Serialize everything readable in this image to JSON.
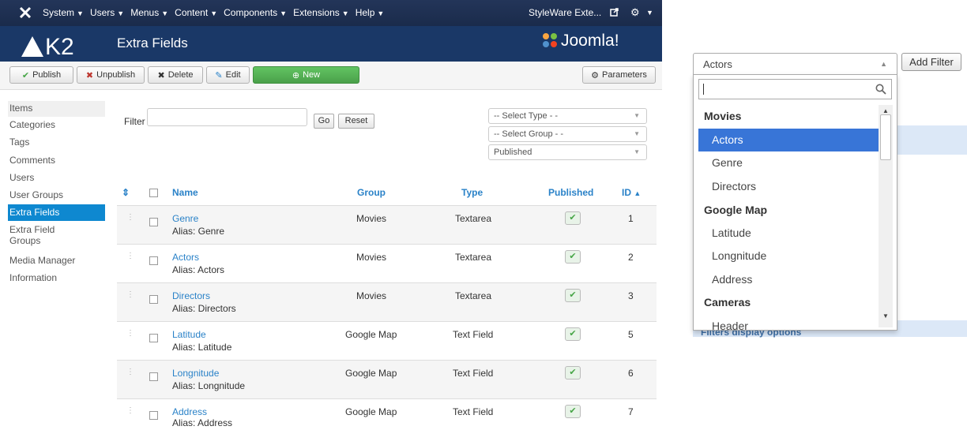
{
  "navbar": {
    "menus": [
      "System",
      "Users",
      "Menus",
      "Content",
      "Components",
      "Extensions",
      "Help"
    ],
    "site_name": "StyleWare Exte...",
    "brand": "Joomla!"
  },
  "header": {
    "logo_text": "K2",
    "title": "Extra Fields"
  },
  "toolbar": {
    "publish": "Publish",
    "unpublish": "Unpublish",
    "delete": "Delete",
    "edit": "Edit",
    "new": "New",
    "parameters": "Parameters"
  },
  "sidebar": [
    "Items",
    "Categories",
    "Tags",
    "Comments",
    "Users",
    "User Groups",
    "Extra Fields",
    "Extra Field Groups",
    "Media Manager",
    "Information"
  ],
  "filter": {
    "label": "Filter",
    "value": "",
    "go": "Go",
    "reset": "Reset"
  },
  "selects": [
    "-- Select Type - -",
    "-- Select Group - -",
    "Published"
  ],
  "table": {
    "headers": {
      "name": "Name",
      "group": "Group",
      "type": "Type",
      "published": "Published",
      "id": "ID"
    },
    "rows": [
      {
        "name": "Genre",
        "alias": "Alias: Genre",
        "group": "Movies",
        "type": "Textarea",
        "id": "1"
      },
      {
        "name": "Actors",
        "alias": "Alias: Actors",
        "group": "Movies",
        "type": "Textarea",
        "id": "2"
      },
      {
        "name": "Directors",
        "alias": "Alias: Directors",
        "group": "Movies",
        "type": "Textarea",
        "id": "3"
      },
      {
        "name": "Latitude",
        "alias": "Alias: Latitude",
        "group": "Google Map",
        "type": "Text Field",
        "id": "5"
      },
      {
        "name": "Longnitude",
        "alias": "Alias: Longnitude",
        "group": "Google Map",
        "type": "Text Field",
        "id": "6"
      },
      {
        "name": "Address",
        "alias": "Alias: Address",
        "group": "Google Map",
        "type": "Text Field",
        "id": "7"
      }
    ]
  },
  "right_panel": {
    "selected": "Actors",
    "add_filter": "Add Filter",
    "search_value": "",
    "groups": [
      {
        "label": "Movies",
        "options": [
          "Actors",
          "Genre",
          "Directors"
        ]
      },
      {
        "label": "Google Map",
        "options": [
          "Latitude",
          "Longnitude",
          "Address"
        ]
      },
      {
        "label": "Cameras",
        "options": [
          "Header"
        ]
      }
    ],
    "section_label": "Filters display options"
  },
  "colors": {
    "navbar": "#1a2b4b",
    "header": "#1a3867",
    "accent": "#2a82c8",
    "active": "#0e88d0",
    "new_button": "#5bb75b",
    "selected_option": "#3875d7"
  }
}
